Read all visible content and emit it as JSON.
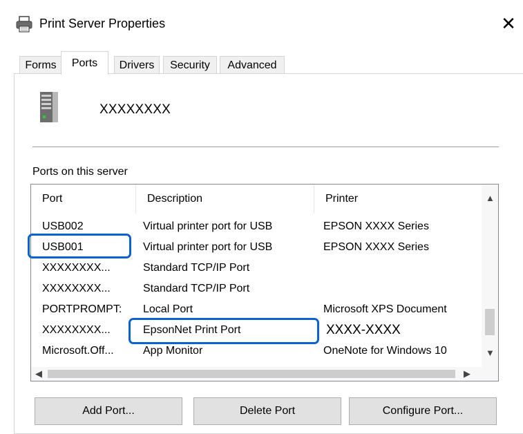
{
  "window": {
    "title": "Print Server Properties",
    "close_label": "✕"
  },
  "tabs": [
    {
      "label": "Forms"
    },
    {
      "label": "Ports"
    },
    {
      "label": "Drivers"
    },
    {
      "label": "Security"
    },
    {
      "label": "Advanced"
    }
  ],
  "server": {
    "name": "XXXXXXXX"
  },
  "ports_section": {
    "label": "Ports on this server",
    "columns": [
      "Port",
      "Description",
      "Printer"
    ],
    "rows": [
      {
        "port": "USB002",
        "description": "Virtual printer port for USB",
        "printer": "EPSON  XXXX Series"
      },
      {
        "port": "USB001",
        "description": "Virtual printer port for USB",
        "printer": "EPSON  XXXX Series"
      },
      {
        "port": "XXXXXXXX...",
        "description": "Standard TCP/IP Port",
        "printer": ""
      },
      {
        "port": "XXXXXXXX...",
        "description": "Standard TCP/IP Port",
        "printer": ""
      },
      {
        "port": "PORTPROMPT:",
        "description": "Local Port",
        "printer": "Microsoft XPS Document"
      },
      {
        "port": "XXXXXXXX...",
        "description": "EpsonNet Print Port",
        "printer": "XXXX-XXXX"
      },
      {
        "port": "Microsoft.Off...",
        "description": "App Monitor",
        "printer": "OneNote for Windows 10"
      }
    ]
  },
  "buttons": {
    "add_port": "Add Port...",
    "delete_port": "Delete Port",
    "configure_port": "Configure Port..."
  },
  "colors": {
    "highlight": "#0b61d1"
  },
  "icons": [
    "printer-icon",
    "server-icon",
    "close-icon",
    "scroll-up-icon",
    "scroll-down-icon",
    "scroll-left-icon",
    "scroll-right-icon"
  ]
}
